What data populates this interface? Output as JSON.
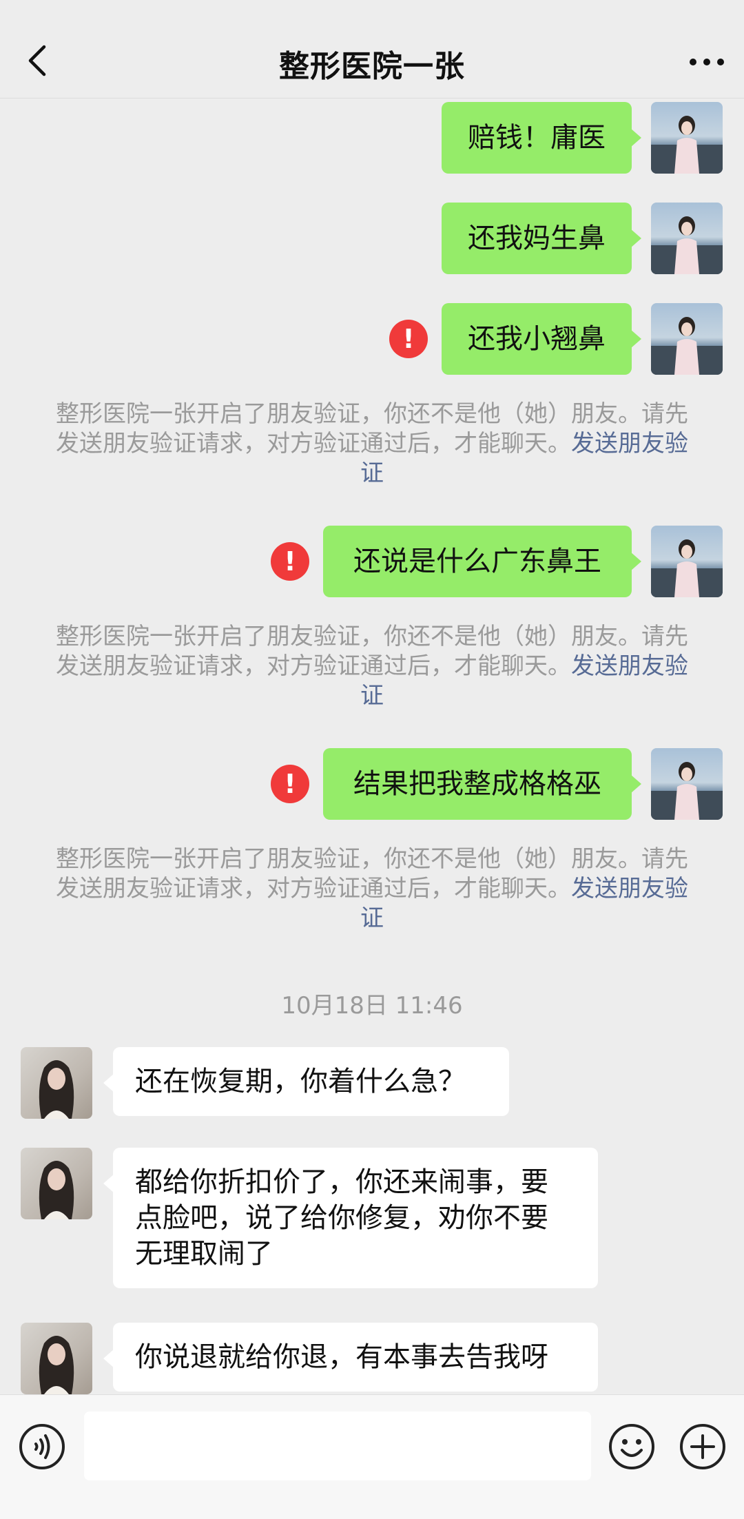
{
  "header": {
    "title": "整形医院一张",
    "back_icon": "chevron-left-icon",
    "more_icon": "more-dots-icon"
  },
  "messages_top": [
    {
      "text": "赔钱！庸医",
      "failed": false
    },
    {
      "text": "还我妈生鼻",
      "failed": false
    },
    {
      "text": "还我小翘鼻",
      "failed": true
    }
  ],
  "system_notice": {
    "text": "整形医院一张开启了朋友验证，你还不是他（她）朋友。请先发送朋友验证请求，对方验证通过后，才能聊天。",
    "link": "发送朋友验证"
  },
  "messages_mid": [
    {
      "text": "还说是什么广东鼻王",
      "failed": true
    },
    {
      "text": "结果把我整成格格巫",
      "failed": true
    }
  ],
  "timestamp": "10月18日 11:46",
  "incoming": [
    {
      "lines": [
        "还在恢复期，你着什么急？"
      ]
    },
    {
      "lines": [
        "都给你折扣价了，你还来闹事，要",
        "点脸吧，说了给你修复，劝你不要",
        "无理取闹了"
      ]
    },
    {
      "lines": [
        "你说退就给你退，有本事去告我呀"
      ]
    }
  ],
  "input_bar": {
    "placeholder": "",
    "voice_icon": "voice-icon",
    "emoji_icon": "emoji-icon",
    "plus_icon": "plus-icon"
  },
  "colors": {
    "outgoing_bubble": "#95ec69",
    "incoming_bubble": "#ffffff",
    "background": "#ededed",
    "fail_icon": "#f03a3a",
    "link": "#576b95"
  }
}
